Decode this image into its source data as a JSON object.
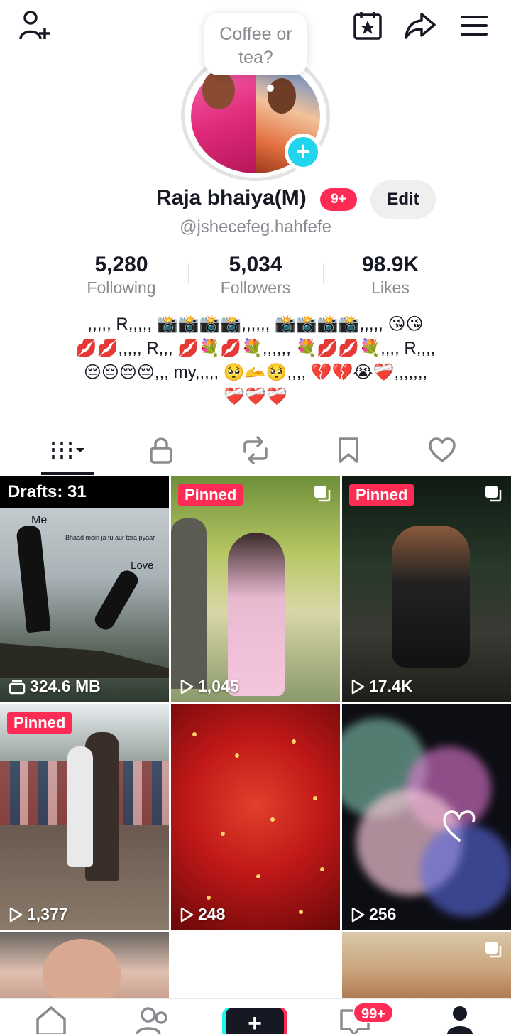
{
  "bubble": {
    "text_line1": "Coffee or",
    "text_line2": "tea?"
  },
  "profile": {
    "name": "Raja bhaiya(M)",
    "badge": "9+",
    "edit_label": "Edit",
    "handle": "@jshecefeg.hahfefe"
  },
  "stats": [
    {
      "value": "5,280",
      "label": "Following"
    },
    {
      "value": "5,034",
      "label": "Followers"
    },
    {
      "value": "98.9K",
      "label": "Likes"
    }
  ],
  "bio": {
    "line1": ",,,,, R,,,,, 📸📸📸📸,,,,,, 📸📸📸📸,,,,, 😘😘",
    "line2": "💋💋,,,,, R,,, 💋💐💋💐,,,,,, 💐💋💋💐,,,, R,,,,",
    "line3": "😔😔😔😔,,, my,,,,, 🥺🫴🥺,,,, 💔💔😭❤️‍🩹,,,,,,,",
    "line4": "❤️‍🩹❤️‍🩹❤️‍🩹"
  },
  "grid": {
    "drafts_label": "Drafts: 31",
    "drafts_size": "324.6 MB",
    "pinned_label": "Pinned",
    "draft_overlay": {
      "me": "Me",
      "caption": "Bhaad mein ja tu aur tera pyaar",
      "love": "Love"
    },
    "views": [
      "1,045",
      "17.4K",
      "1,377",
      "248",
      "256"
    ]
  },
  "nav": {
    "inbox_badge": "99+"
  },
  "colors": {
    "accent": "#fe2c55",
    "cyan": "#20d5ec",
    "muted": "#8a8b91"
  }
}
